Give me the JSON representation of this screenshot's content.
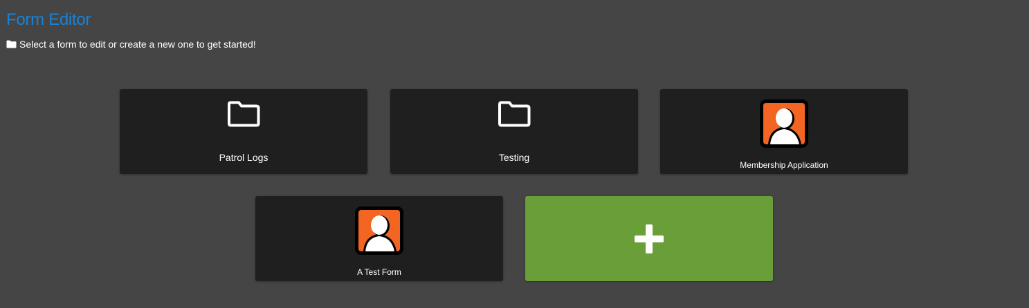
{
  "header": {
    "title": "Form Editor",
    "subtitle_icon": "folder-icon",
    "subtitle": "Select a form to edit or create a new one to get started!"
  },
  "colors": {
    "background": "#454545",
    "title": "#1a82d4",
    "card": "#1f1f1f",
    "add_card": "#6a9e38",
    "avatar_orange": "#f26522"
  },
  "cards": [
    {
      "type": "folder",
      "icon": "folder-icon",
      "label": "Patrol Logs"
    },
    {
      "type": "folder",
      "icon": "folder-icon",
      "label": "Testing"
    },
    {
      "type": "form",
      "icon": "user-avatar-icon",
      "label": "Membership Application"
    },
    {
      "type": "form",
      "icon": "user-avatar-icon",
      "label": "A Test Form"
    }
  ],
  "add_card": {
    "icon": "plus-icon"
  }
}
